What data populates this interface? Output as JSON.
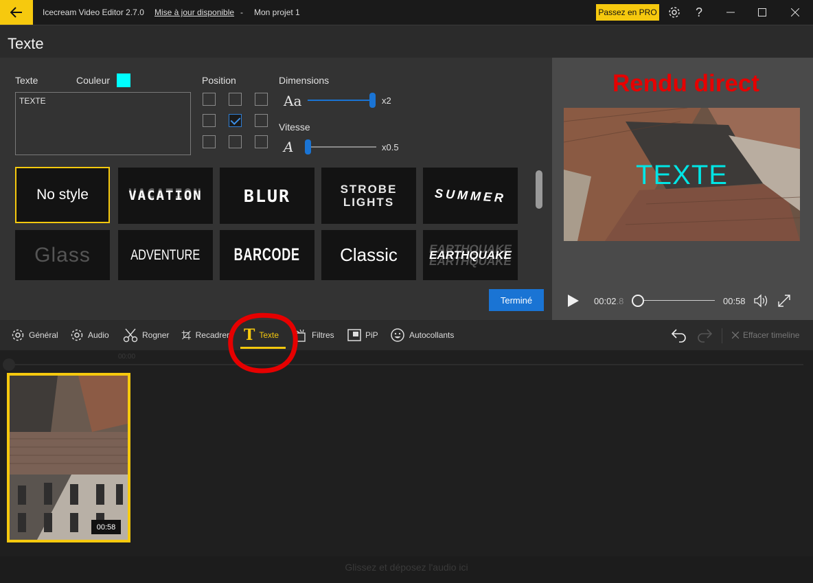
{
  "titlebar": {
    "app_name": "Icecream Video Editor 2.7.0",
    "update_link": "Mise à jour disponible",
    "separator": "-",
    "project_name": "Mon projet 1",
    "pro_button": "Passez en PRO",
    "icons": [
      "back-arrow-icon",
      "gear-icon",
      "help-icon",
      "minimize-icon",
      "maximize-icon",
      "close-icon"
    ]
  },
  "page": {
    "title": "Texte"
  },
  "editor": {
    "text_label": "Texte",
    "color_label": "Couleur",
    "color_value": "#00ffff",
    "text_value": "TEXTE",
    "position_label": "Position",
    "position_grid": [
      [
        false,
        false,
        false
      ],
      [
        false,
        true,
        false
      ],
      [
        false,
        false,
        false
      ]
    ],
    "dimensions_label": "Dimensions",
    "size_value": "x2",
    "size_slider_fraction": 0.98,
    "speed_label": "Vitesse",
    "speed_value": "x0.5",
    "speed_slider_fraction": 0.0,
    "styles": [
      "No style",
      "VACATION",
      "BLUR",
      "STROBE LIGHTS",
      "SUMMER",
      "Glass",
      "ADVENTURE",
      "BARCODE",
      "Classic",
      "EARTHQUAKE"
    ],
    "selected_style": "No style",
    "done_button": "Terminé"
  },
  "preview": {
    "title": "Rendu direct",
    "overlay_text": "TEXTE",
    "current_time": "00:02",
    "current_time_fraction": ".8",
    "total_time": "00:58",
    "progress_fraction": 0.03
  },
  "toolbar": {
    "items": [
      "Général",
      "Audio",
      "Rogner",
      "Recadrer",
      "Texte",
      "Filtres",
      "PiP",
      "Autocollants"
    ],
    "active": "Texte",
    "clear_timeline": "Effacer timeline"
  },
  "timeline": {
    "ruler_label": "00:00",
    "clip_duration": "00:58",
    "audio_hint": "Glissez et déposez l'audio ici"
  },
  "colors": {
    "accent": "#f6c90e",
    "primary": "#1a74d4",
    "annotation": "#e60000"
  }
}
